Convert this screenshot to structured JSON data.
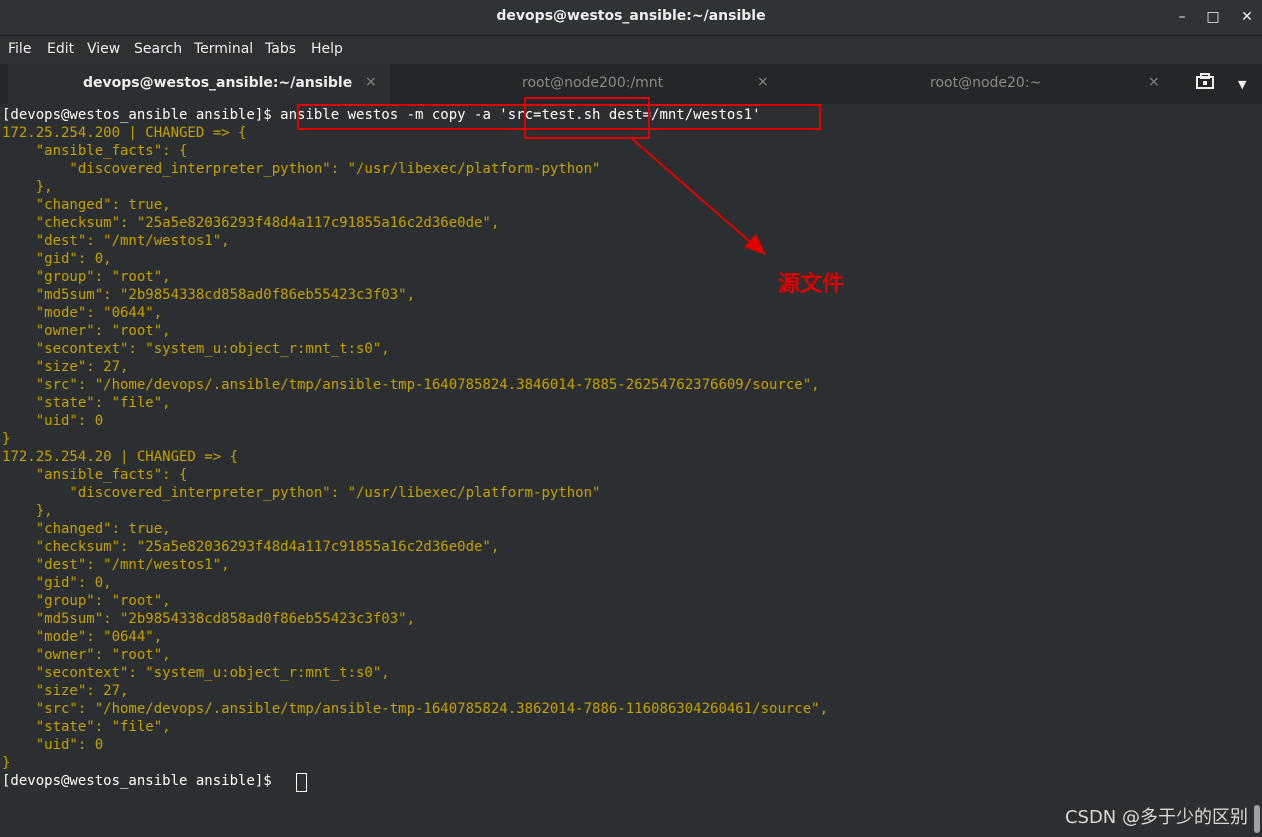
{
  "window": {
    "title": "devops@westos_ansible:~/ansible",
    "minimize": "–",
    "maximize": "□",
    "close": "✕"
  },
  "menu": [
    "File",
    "Edit",
    "View",
    "Search",
    "Terminal",
    "Tabs",
    "Help"
  ],
  "tabs": [
    {
      "label": "devops@westos_ansible:~/ansible",
      "close": "×",
      "active": true
    },
    {
      "label": "root@node200:/mnt",
      "close": "×",
      "active": false
    },
    {
      "label": "root@node20:~",
      "close": "×",
      "active": false
    }
  ],
  "tab_icons": {
    "new_tab_icon": "terminal-tab-icon",
    "menu_icon": "▼"
  },
  "terminal": {
    "prompt1": "[devops@westos_ansible ansible]$ ",
    "command": "ansible westos -m copy -a 'src=test.sh dest=/mnt/westos1'",
    "output": [
      "172.25.254.200 | CHANGED => {",
      "    \"ansible_facts\": {",
      "        \"discovered_interpreter_python\": \"/usr/libexec/platform-python\"",
      "    },",
      "    \"changed\": true,",
      "    \"checksum\": \"25a5e82036293f48d4a117c91855a16c2d36e0de\",",
      "    \"dest\": \"/mnt/westos1\",",
      "    \"gid\": 0,",
      "    \"group\": \"root\",",
      "    \"md5sum\": \"2b9854338cd858ad0f86eb55423c3f03\",",
      "    \"mode\": \"0644\",",
      "    \"owner\": \"root\",",
      "    \"secontext\": \"system_u:object_r:mnt_t:s0\",",
      "    \"size\": 27,",
      "    \"src\": \"/home/devops/.ansible/tmp/ansible-tmp-1640785824.3846014-7885-26254762376609/source\",",
      "    \"state\": \"file\",",
      "    \"uid\": 0",
      "}",
      "172.25.254.20 | CHANGED => {",
      "    \"ansible_facts\": {",
      "        \"discovered_interpreter_python\": \"/usr/libexec/platform-python\"",
      "    },",
      "    \"changed\": true,",
      "    \"checksum\": \"25a5e82036293f48d4a117c91855a16c2d36e0de\",",
      "    \"dest\": \"/mnt/westos1\",",
      "    \"gid\": 0,",
      "    \"group\": \"root\",",
      "    \"md5sum\": \"2b9854338cd858ad0f86eb55423c3f03\",",
      "    \"mode\": \"0644\",",
      "    \"owner\": \"root\",",
      "    \"secontext\": \"system_u:object_r:mnt_t:s0\",",
      "    \"size\": 27,",
      "    \"src\": \"/home/devops/.ansible/tmp/ansible-tmp-1640785824.3862014-7886-116086304260461/source\",",
      "    \"state\": \"file\",",
      "    \"uid\": 0",
      "}"
    ],
    "prompt2": "[devops@westos_ansible ansible]$ "
  },
  "annotation": {
    "label": "源文件",
    "color": "#e00000"
  },
  "watermark": "CSDN @多于少的区别",
  "colors": {
    "output": "#c4a000",
    "prompt": "#ffffff",
    "background": "#2b2f31"
  }
}
